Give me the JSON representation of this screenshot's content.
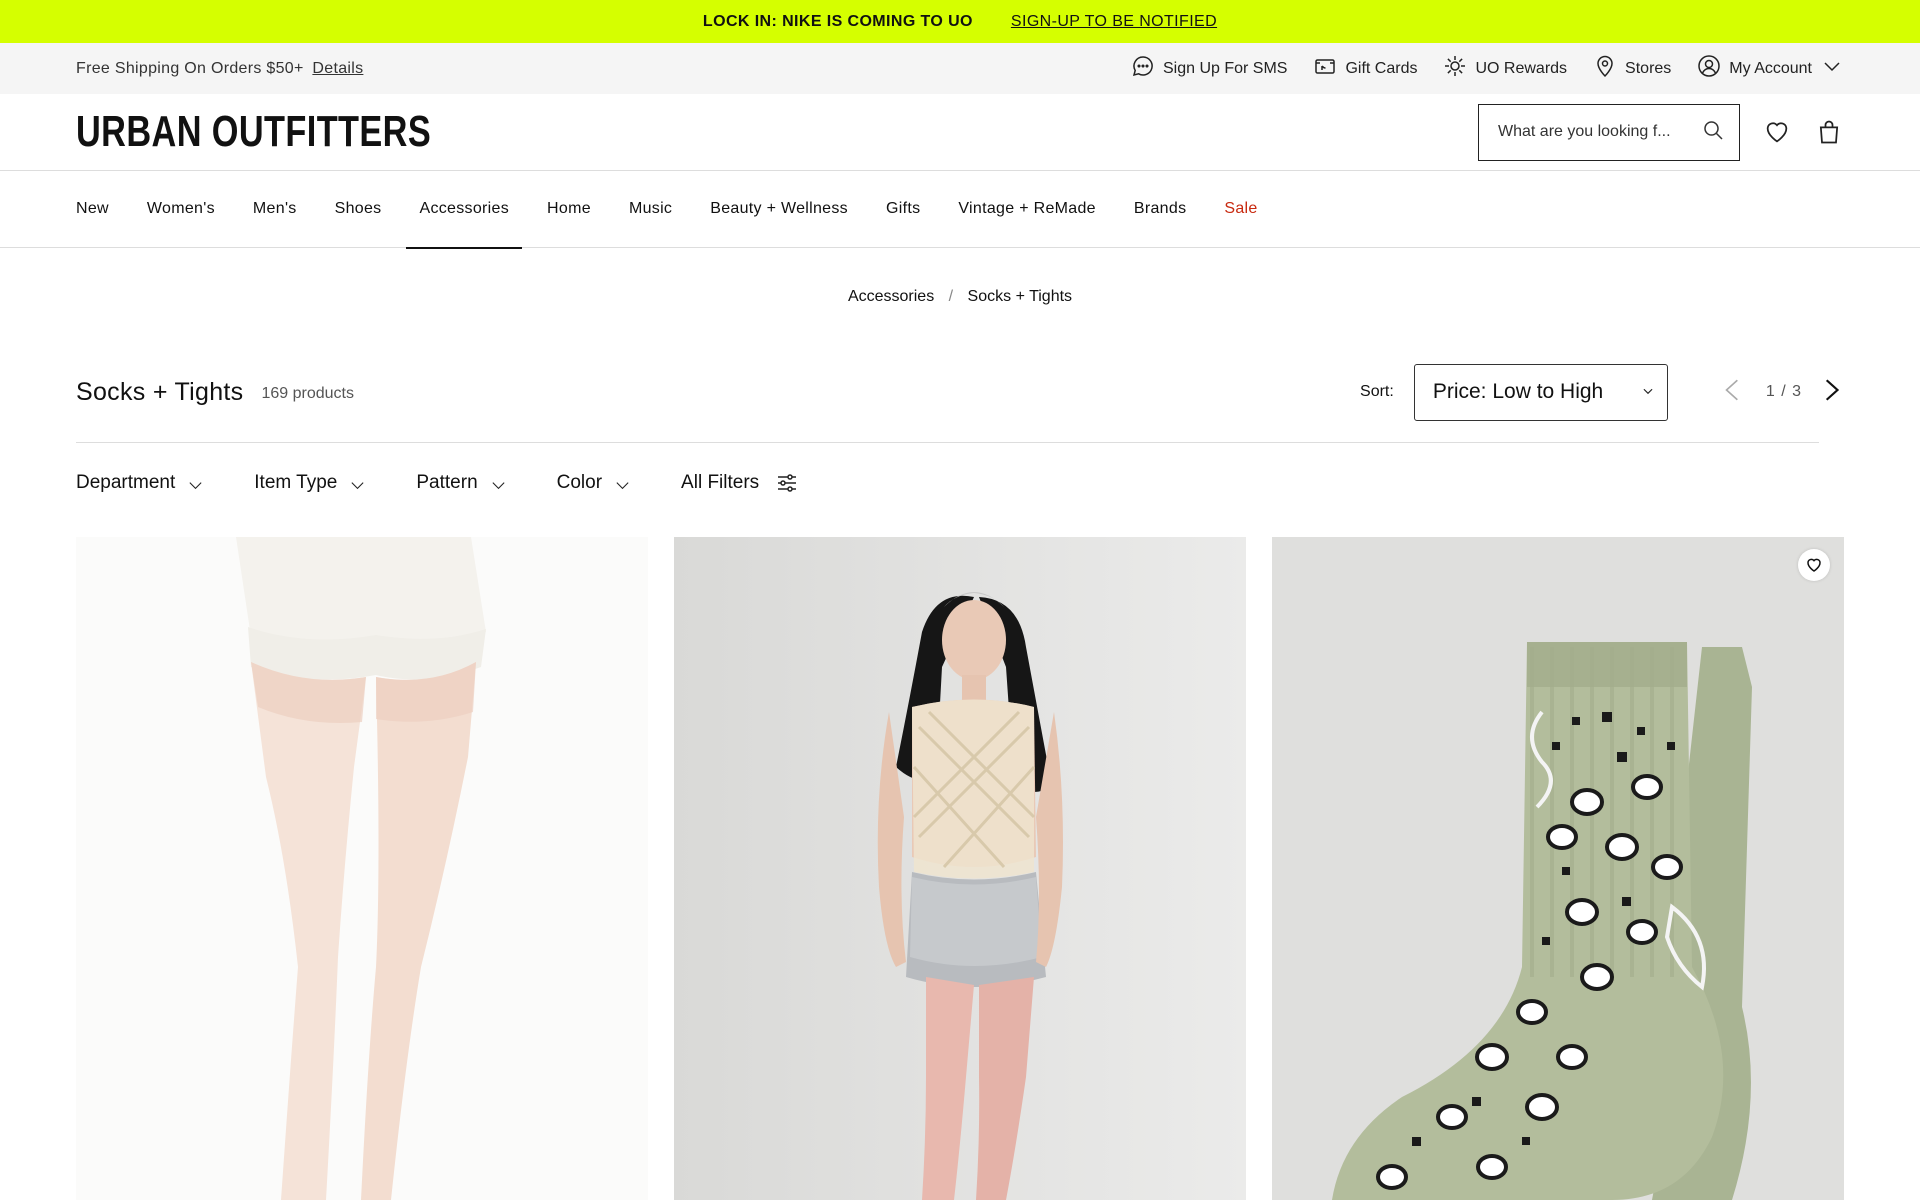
{
  "promo": {
    "headline": "LOCK IN: NIKE IS COMING TO UO",
    "cta": "SIGN-UP TO BE NOTIFIED"
  },
  "utility": {
    "shipping": "Free Shipping On Orders $50+",
    "details": "Details",
    "links": [
      {
        "label": "Sign Up For SMS",
        "icon": "chat-icon"
      },
      {
        "label": "Gift Cards",
        "icon": "gift-card-icon"
      },
      {
        "label": "UO Rewards",
        "icon": "rewards-icon"
      },
      {
        "label": "Stores",
        "icon": "location-pin-icon"
      },
      {
        "label": "My Account",
        "icon": "account-icon"
      }
    ]
  },
  "header": {
    "logo": "URBAN OUTFITTERS",
    "search_placeholder": "What are you looking f..."
  },
  "nav": {
    "items": [
      "New",
      "Women's",
      "Men's",
      "Shoes",
      "Accessories",
      "Home",
      "Music",
      "Beauty + Wellness",
      "Gifts",
      "Vintage + ReMade",
      "Brands",
      "Sale"
    ],
    "active": "Accessories"
  },
  "breadcrumb": {
    "parent": "Accessories",
    "separator": "/",
    "current": "Socks + Tights"
  },
  "listing": {
    "title": "Socks + Tights",
    "count": "169 products",
    "sort_label": "Sort:",
    "sort_value": "Price: Low to High",
    "page": "1",
    "page_sep": "/",
    "pages": "3"
  },
  "filters": [
    "Department",
    "Item Type",
    "Pattern",
    "Color",
    "All Filters"
  ],
  "colors": {
    "promo_bg": "#d5ff00",
    "sale": "#c8290f"
  }
}
